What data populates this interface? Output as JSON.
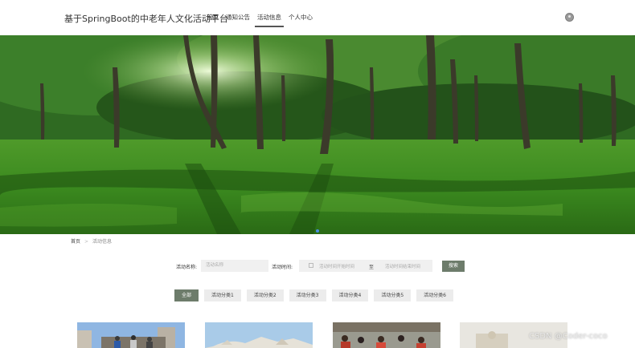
{
  "header": {
    "site_title": "基于SpringBoot的中老年人文化活动平台",
    "nav": [
      {
        "label": "首页",
        "active": false
      },
      {
        "label": "通知公告",
        "active": false
      },
      {
        "label": "活动信息",
        "active": true
      },
      {
        "label": "个人中心",
        "active": false
      }
    ],
    "user_icon": "user-avatar-icon"
  },
  "banner": {
    "image": "forest-photo",
    "active_slide": 1
  },
  "breadcrumb": {
    "home": "首页",
    "separator": ">",
    "current": "活动信息"
  },
  "search": {
    "name_label": "活动名称:",
    "name_placeholder": "活动名称",
    "time_label": "活动时间:",
    "start_placeholder": "活动时间开始时间",
    "to": "至",
    "end_placeholder": "活动时间结束时间",
    "button": "搜索"
  },
  "categories": [
    {
      "label": "全部",
      "active": true
    },
    {
      "label": "活动分类1",
      "active": false
    },
    {
      "label": "活动分类2",
      "active": false
    },
    {
      "label": "活动分类3",
      "active": false
    },
    {
      "label": "活动分类4",
      "active": false
    },
    {
      "label": "活动分类5",
      "active": false
    },
    {
      "label": "活动分类6",
      "active": false
    }
  ],
  "watermark": "CSDN @Coder-coco",
  "colors": {
    "accent": "#6d7c6b",
    "category_bg": "#ececec",
    "input_bg": "#f0f0f0"
  }
}
